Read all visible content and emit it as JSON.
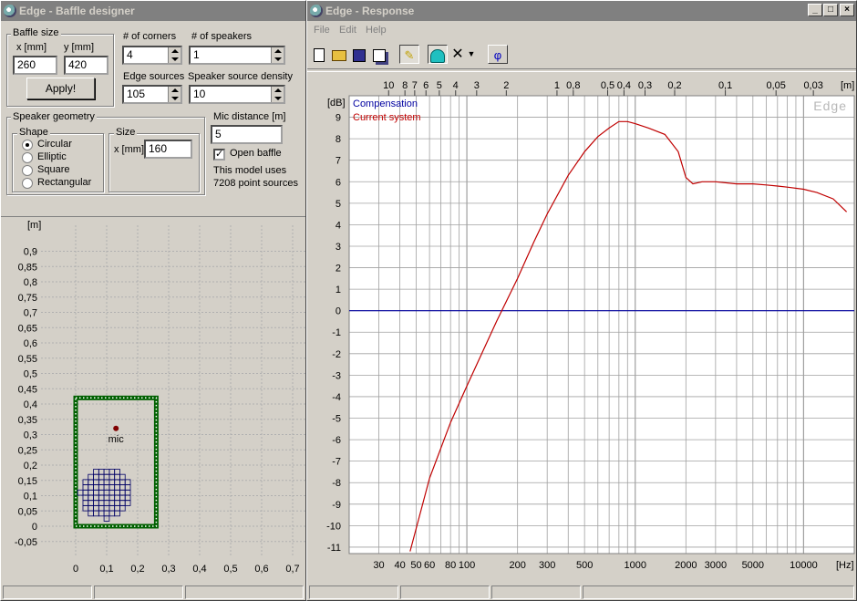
{
  "baffle_window": {
    "title": "Edge - Baffle designer",
    "baffle_size": {
      "label": "Baffle size",
      "x_label": "x [mm]",
      "y_label": "y [mm]",
      "x_value": "260",
      "y_value": "420",
      "apply_label": "Apply!"
    },
    "corners": {
      "label": "# of corners",
      "value": "4"
    },
    "speakers": {
      "label": "# of speakers",
      "value": "1"
    },
    "edge_sources": {
      "label": "Edge sources",
      "value": "105"
    },
    "speaker_density": {
      "label": "Speaker source density",
      "value": "10"
    },
    "speaker_geometry": {
      "label": "Speaker geometry",
      "shape_label": "Shape",
      "shapes": [
        "Circular",
        "Elliptic",
        "Square",
        "Rectangular"
      ],
      "selected": "Circular",
      "size_label": "Size",
      "size_x_label": "x [mm]",
      "size_value": "160"
    },
    "mic_distance": {
      "label": "Mic distance [m]",
      "value": "5"
    },
    "open_baffle": {
      "label": "Open baffle",
      "checked": true
    },
    "model_info": [
      "This model uses",
      "7208 point sources"
    ],
    "plot": {
      "unit_label": "[m]",
      "y_ticks": [
        "0,9",
        "0,85",
        "0,8",
        "0,75",
        "0,7",
        "0,65",
        "0,6",
        "0,55",
        "0,5",
        "0,45",
        "0,4",
        "0,35",
        "0,3",
        "0,25",
        "0,2",
        "0,15",
        "0,1",
        "0,05",
        "0",
        "-0,05"
      ],
      "x_ticks": [
        "0",
        "0,1",
        "0,2",
        "0,3",
        "0,4",
        "0,5",
        "0,6",
        "0,7"
      ],
      "mic_label": "mic",
      "baffle_m": {
        "width": 0.26,
        "height": 0.42
      },
      "mic_m": {
        "x": 0.13,
        "y": 0.32
      },
      "speaker_m": {
        "cx": 0.1,
        "cy": 0.11,
        "r": 0.085
      }
    }
  },
  "response_window": {
    "title": "Edge - Response",
    "menu": [
      "File",
      "Edit",
      "Help"
    ],
    "toolbar": [
      "new-icon",
      "open-icon",
      "save-icon",
      "copy-icon",
      "draw-icon",
      "speaker-icon",
      "delete-icon",
      "dropdown-icon",
      "phase-icon"
    ],
    "phase_glyph": "φ",
    "watermark": "Edge",
    "chart_data": {
      "type": "line",
      "ylabel": "[dB]",
      "xlabel": "[Hz]",
      "top_axis_label": "[m]",
      "ylim": [
        -11.3,
        10
      ],
      "xlim": [
        20,
        20000
      ],
      "x_scale": "log",
      "y_ticks": [
        "9",
        "8",
        "7",
        "6",
        "5",
        "4",
        "3",
        "2",
        "1",
        "0",
        "-1",
        "-2",
        "-3",
        "-4",
        "-5",
        "-6",
        "-7",
        "-8",
        "-9",
        "-10",
        "-11"
      ],
      "x_tick_labels": [
        "30",
        "40",
        "50",
        "60",
        "80",
        "100",
        "200",
        "300",
        "500",
        "1000",
        "2000",
        "3000",
        "5000",
        "10000"
      ],
      "top_tick_labels": [
        "10",
        "8",
        "7",
        "6",
        "5",
        "4",
        "3",
        "2",
        "1",
        "0,8",
        "0,5",
        "0,4",
        "0,3",
        "0,2",
        "0,1",
        "0,05",
        "0,03"
      ],
      "series": [
        {
          "name": "Compensation",
          "color": "#0000a0",
          "x": [
            20,
            20000
          ],
          "y": [
            0,
            0
          ]
        },
        {
          "name": "Current system",
          "color": "#c00000",
          "x": [
            46,
            60,
            80,
            100,
            150,
            200,
            250,
            300,
            400,
            500,
            600,
            700,
            800,
            900,
            1000,
            1200,
            1500,
            1800,
            2000,
            2200,
            2500,
            3000,
            4000,
            5000,
            6000,
            7000,
            8000,
            10000,
            12000,
            15000,
            18000
          ],
          "y": [
            -11.2,
            -7.8,
            -5.2,
            -3.5,
            -0.5,
            1.5,
            3.2,
            4.5,
            6.3,
            7.4,
            8.1,
            8.5,
            8.8,
            8.8,
            8.7,
            8.5,
            8.2,
            7.4,
            6.2,
            5.9,
            6.0,
            6.0,
            5.9,
            5.9,
            5.85,
            5.8,
            5.75,
            5.65,
            5.5,
            5.2,
            4.6
          ]
        }
      ]
    }
  }
}
